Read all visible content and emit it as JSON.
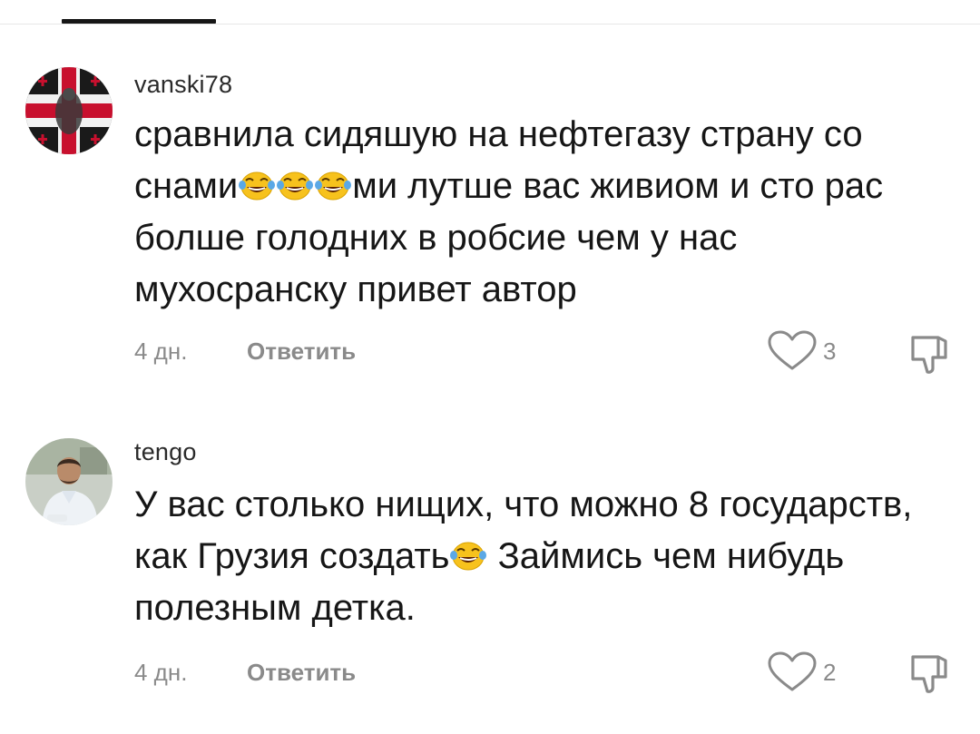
{
  "comments": [
    {
      "username": "vanski78",
      "text_parts": [
        "сравнила сидяшую на нефтегазу страну со снами",
        "ми лутше вас живиом и сто рас болше голодних в робсие чем у нас мухосранску привет автор"
      ],
      "time": "4 дн.",
      "reply_label": "Ответить",
      "likes": "3"
    },
    {
      "username": "tengo",
      "text_parts": [
        "У вас столько нищих, что можно 8 государств, как Грузия создать",
        " Займись чем нибудь полезным детка."
      ],
      "time": "4 дн.",
      "reply_label": "Ответить",
      "likes": "2"
    }
  ],
  "colors": {
    "text": "#161616",
    "muted": "#8a8a8a",
    "emoji_face": "#f7c21d",
    "tear": "#5aa8e6"
  }
}
